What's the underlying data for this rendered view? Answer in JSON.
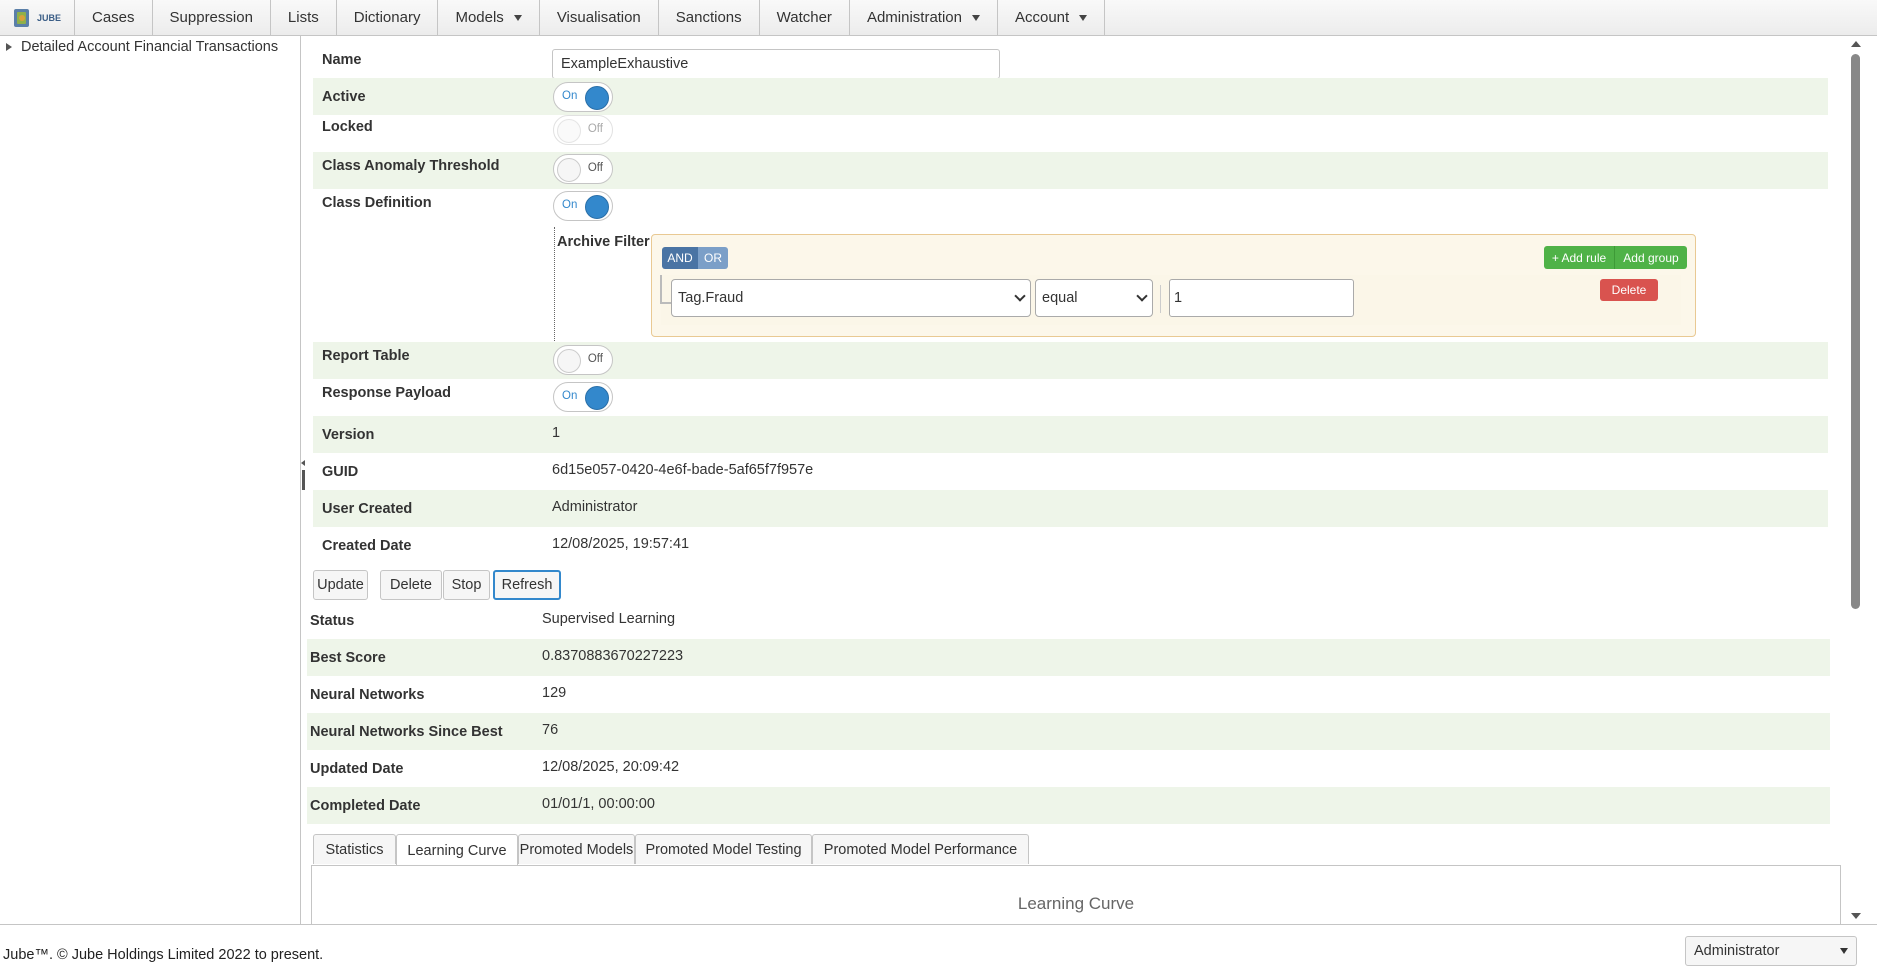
{
  "nav": {
    "logo_text": "JUBE",
    "items": [
      {
        "label": "Cases",
        "dropdown": false
      },
      {
        "label": "Suppression",
        "dropdown": false
      },
      {
        "label": "Lists",
        "dropdown": false
      },
      {
        "label": "Dictionary",
        "dropdown": false
      },
      {
        "label": "Models",
        "dropdown": true
      },
      {
        "label": "Visualisation",
        "dropdown": false
      },
      {
        "label": "Sanctions",
        "dropdown": false
      },
      {
        "label": "Watcher",
        "dropdown": false
      },
      {
        "label": "Administration",
        "dropdown": true
      },
      {
        "label": "Account",
        "dropdown": true
      }
    ]
  },
  "tree": {
    "items": [
      {
        "label": "Detailed Account Financial Transactions"
      }
    ]
  },
  "form": {
    "name_label": "Name",
    "name_value": "ExampleExhaustive",
    "active_label": "Active",
    "active_state": "On",
    "locked_label": "Locked",
    "locked_state": "Off",
    "class_anomaly_label": "Class Anomaly Threshold",
    "class_anomaly_state": "Off",
    "class_definition_label": "Class Definition",
    "class_definition_state": "On",
    "archive_filter_label": "Archive Filter",
    "report_table_label": "Report Table",
    "report_table_state": "Off",
    "response_payload_label": "Response Payload",
    "response_payload_state": "On",
    "version_label": "Version",
    "version_value": "1",
    "guid_label": "GUID",
    "guid_value": "6d15e057-0420-4e6f-bade-5af65f7f957e",
    "user_created_label": "User Created",
    "user_created_value": "Administrator",
    "created_date_label": "Created Date",
    "created_date_value": "12/08/2025, 19:57:41"
  },
  "query_builder": {
    "and_label": "AND",
    "or_label": "OR",
    "add_rule_label": "+ Add rule",
    "add_group_label": "Add group",
    "rule": {
      "field": "Tag.Fraud",
      "operator": "equal",
      "value": "1",
      "delete_label": "Delete"
    },
    "colors": {
      "and": "#4a74a4",
      "or": "#7b9fc8",
      "add": "#4fb247",
      "delete": "#d9534f",
      "panel_bg": "#fcf7ea",
      "panel_border": "#e9c993"
    }
  },
  "actions": {
    "update": "Update",
    "delete": "Delete",
    "stop": "Stop",
    "refresh": "Refresh"
  },
  "status": {
    "status_label": "Status",
    "status_value": "Supervised Learning",
    "best_score_label": "Best Score",
    "best_score_value": "0.8370883670227223",
    "neural_networks_label": "Neural Networks",
    "neural_networks_value": "129",
    "nn_since_best_label": "Neural Networks Since Best",
    "nn_since_best_value": "76",
    "updated_date_label": "Updated Date",
    "updated_date_value": "12/08/2025, 20:09:42",
    "completed_date_label": "Completed Date",
    "completed_date_value": "01/01/1, 00:00:00"
  },
  "tabs": {
    "items": [
      {
        "label": "Statistics"
      },
      {
        "label": "Learning Curve"
      },
      {
        "label": "Promoted Models"
      },
      {
        "label": "Promoted Model Testing"
      },
      {
        "label": "Promoted Model Performance"
      }
    ],
    "active": "Learning Curve",
    "panel_title": "Learning Curve"
  },
  "footer": {
    "copyright": "Jube™. © Jube Holdings Limited 2022 to present.",
    "user": "Administrator"
  },
  "theme": {
    "accent": "#3388cc",
    "row_alt": "#eef5e9",
    "border": "#c5c5c5"
  }
}
